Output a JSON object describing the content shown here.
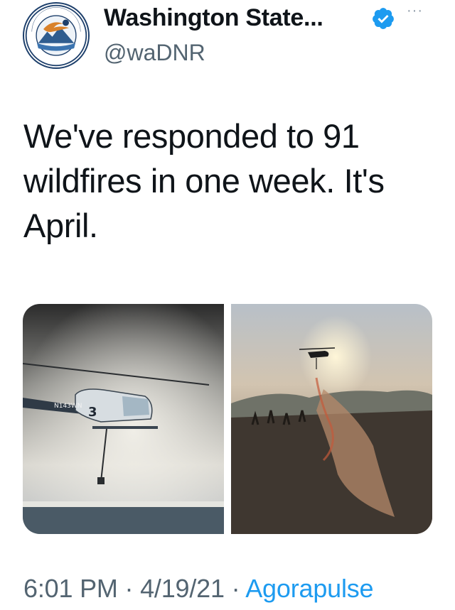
{
  "account": {
    "display_name": "Washington State...",
    "handle": "@waDNR",
    "verified": true,
    "avatar_text_top": "WASHINGTON",
    "avatar_text_side": "DEPARTMENT OF NATURAL RESOURCES"
  },
  "tweet": {
    "text": "We've responded to 91 wildfires in one week. It's April.",
    "media": [
      {
        "type": "photo",
        "helicopter_label": "N143WN",
        "helicopter_number": "3"
      },
      {
        "type": "photo"
      }
    ]
  },
  "meta": {
    "time": "6:01 PM",
    "separator": "·",
    "date": "4/19/21",
    "source": "Agorapulse"
  },
  "colors": {
    "accent": "#1d9bf0",
    "text": "#0f1419",
    "secondary": "#536471"
  },
  "icons": {
    "verified": "verified-badge-icon",
    "more": "more-icon"
  }
}
